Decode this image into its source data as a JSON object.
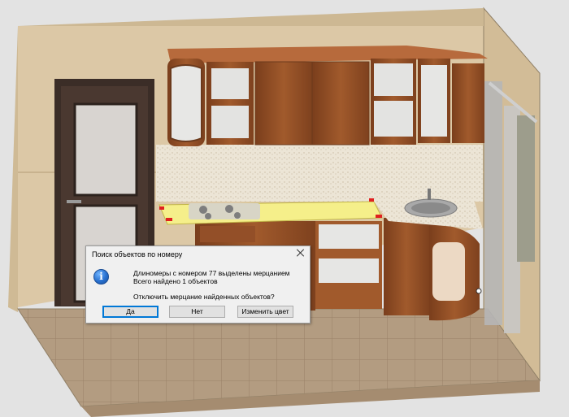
{
  "dialog": {
    "title": "Поиск объектов по номеру",
    "icon": "info-icon",
    "message_line1": "Длиномеры с номером 77 выделены мерцанием",
    "message_line2": "Всего найдено 1 объектов",
    "question": "Отключить мерцание найденных объектов?",
    "buttons": {
      "yes": "Да",
      "no": "Нет",
      "change_color": "Изменить цвет"
    }
  },
  "colors": {
    "wall": "#d8c4a2",
    "floor": "#b39c81",
    "cabinet_wood": "#8c4c26",
    "door": "#3f3029",
    "highlight": "#f5ef8a",
    "dialog_bg": "#f0f0f0",
    "accent": "#0078d7"
  }
}
